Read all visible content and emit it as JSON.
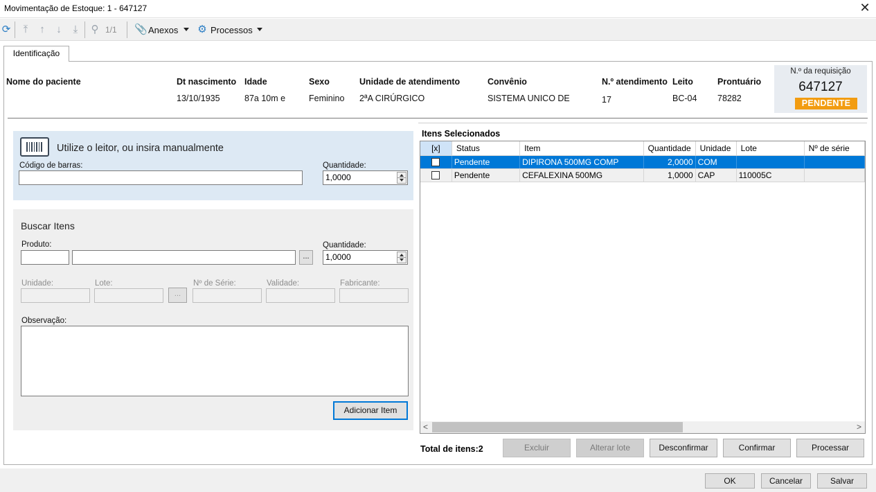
{
  "window": {
    "title": "Movimentação de Estoque: 1 - 647127",
    "close": "✕"
  },
  "toolbar": {
    "nav_count": "1/1",
    "attachments_label": "Anexos",
    "processes_label": "Processos"
  },
  "tabs": [
    {
      "label": "Identificação"
    }
  ],
  "patient": {
    "headers": {
      "name": "Nome do paciente",
      "birth": "Dt nascimento",
      "age": "Idade",
      "sex": "Sexo",
      "unit": "Unidade de atendimento",
      "insurance": "Convênio",
      "attendance": "N.º atendimento",
      "bed": "Leito",
      "record": "Prontuário"
    },
    "values": {
      "name": "",
      "birth": "13/10/1935",
      "age": "87a 10m  e",
      "sex": "Feminino",
      "unit": "2ªA CIRÚRGICO",
      "insurance": "SISTEMA UNICO DE",
      "attendance": "17",
      "bed": "BC-04",
      "record": "78282"
    }
  },
  "requisition": {
    "label": "N.º da requisição",
    "number": "647127",
    "status": "PENDENTE",
    "status_color": "#f29c11"
  },
  "scanner": {
    "title": "Utilize o leitor, ou insira manualmente",
    "barcode_label": "Código de barras:",
    "barcode_value": "",
    "quantity_label": "Quantidade:",
    "quantity_value": "1,0000"
  },
  "search": {
    "title": "Buscar Itens",
    "product_label": "Produto:",
    "product_code": "",
    "product_name": "",
    "browse": "...",
    "quantity_label": "Quantidade:",
    "quantity_value": "1,0000",
    "unit_label": "Unidade:",
    "lot_label": "Lote:",
    "serial_label": "Nº de Série:",
    "validity_label": "Validade:",
    "manufacturer_label": "Fabricante:",
    "notes_label": "Observação:",
    "add_button": "Adicionar Item"
  },
  "selected": {
    "title": "Itens Selecionados",
    "columns": [
      "[x]",
      "Status",
      "Item",
      "Quantidade",
      "Unidade",
      "Lote",
      "Nº de série"
    ],
    "rows": [
      {
        "status": "Pendente",
        "item": "DIPIRONA 500MG COMP",
        "quantity": "2,0000",
        "unit": "COM",
        "lot": "",
        "serial": "",
        "selected": true
      },
      {
        "status": "Pendente",
        "item": "CEFALEXINA 500MG",
        "quantity": "1,0000",
        "unit": "CAP",
        "lot": "110005C",
        "serial": "",
        "selected": false
      }
    ],
    "total": "Total de itens:2",
    "buttons": {
      "delete": "Excluir",
      "change_lot": "Alterar lote",
      "unconfirm": "Desconfirmar",
      "confirm": "Confirmar",
      "process": "Processar"
    }
  },
  "footer": {
    "ok": "OK",
    "cancel": "Cancelar",
    "save": "Salvar"
  }
}
